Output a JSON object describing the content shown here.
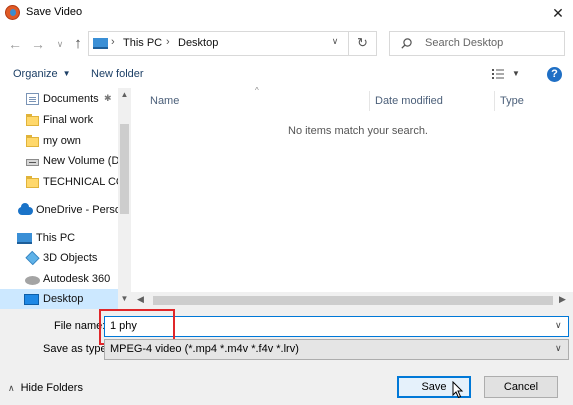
{
  "window": {
    "title": "Save Video",
    "close_glyph": "✕"
  },
  "nav": {
    "back_glyph": "←",
    "forward_glyph": "→",
    "history_glyph": "∨",
    "up_glyph": "↑",
    "breadcrumb": [
      "This PC",
      "Desktop"
    ],
    "separator": "›",
    "refresh_glyph": "↻",
    "search_placeholder": "Search Desktop"
  },
  "toolbar": {
    "organize_label": "Organize",
    "new_folder_label": "New folder",
    "help_glyph": "?"
  },
  "sidebar": {
    "items": [
      {
        "label": "Documents",
        "icon": "documents-icon",
        "pinned": true
      },
      {
        "label": "Final work",
        "icon": "folder-icon"
      },
      {
        "label": "my own",
        "icon": "folder-icon"
      },
      {
        "label": "New Volume (D:",
        "icon": "drive-icon"
      },
      {
        "label": "TECHNICAL CON",
        "icon": "folder-icon"
      },
      {
        "label": "OneDrive - Persor",
        "icon": "onedrive-icon"
      },
      {
        "label": "This PC",
        "icon": "this-pc-icon"
      },
      {
        "label": "3D Objects",
        "icon": "3d-objects-icon"
      },
      {
        "label": "Autodesk 360",
        "icon": "autodesk-icon"
      },
      {
        "label": "Desktop",
        "icon": "desktop-icon",
        "selected": true
      }
    ]
  },
  "file_list": {
    "columns": [
      "Name",
      "Date modified",
      "Type"
    ],
    "empty_message": "No items match your search."
  },
  "form": {
    "file_name_label": "File name:",
    "file_name_value": "1 phy",
    "save_as_type_label": "Save as type:",
    "save_as_type_value": "MPEG-4 video (*.mp4 *.m4v *.f4v *.lrv)"
  },
  "footer": {
    "hide_folders_label": "Hide Folders",
    "save_label": "Save",
    "cancel_label": "Cancel"
  },
  "colors": {
    "accent": "#0078d7",
    "highlight": "#e0272a",
    "selected_bg": "#cce8ff"
  }
}
